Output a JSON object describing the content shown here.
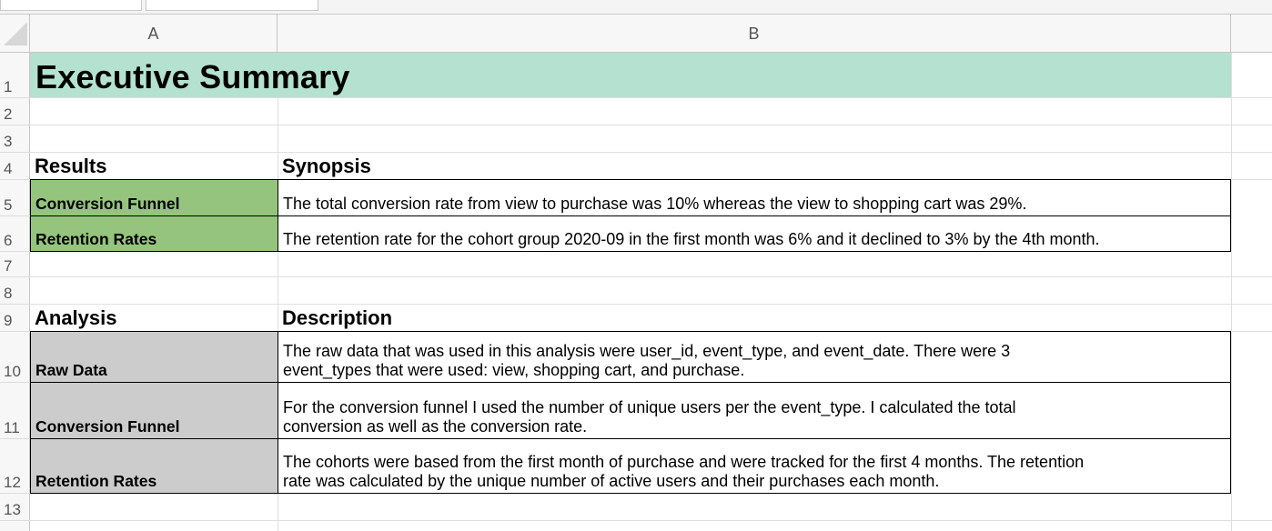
{
  "columns": [
    "A",
    "B"
  ],
  "rows": [
    "1",
    "2",
    "3",
    "4",
    "5",
    "6",
    "7",
    "8",
    "9",
    "10",
    "11",
    "12",
    "13"
  ],
  "sheet": {
    "title": "Executive Summary",
    "results_header": "Results",
    "synopsis_header": "Synopsis",
    "results": [
      {
        "label": "Conversion Funnel",
        "text": "The total conversion rate from view to purchase was 10% whereas the view to shopping cart was 29%."
      },
      {
        "label": "Retention Rates",
        "text": "The retention rate for the cohort group 2020-09 in the first month was 6% and it declined to 3% by the 4th month."
      }
    ],
    "analysis_header": "Analysis",
    "description_header": "Description",
    "analysis": [
      {
        "label": "Raw Data",
        "line1": "The raw data that was used in this analysis were user_id, event_type, and event_date. There were 3",
        "line2": "event_types that were used: view, shopping cart, and purchase."
      },
      {
        "label": "Conversion Funnel",
        "line1": "For the conversion funnel I used the number of unique users per the event_type. I calculated the total",
        "line2": "conversion as well as the conversion rate."
      },
      {
        "label": "Retention Rates",
        "line1": "The cohorts were based from the first month of purchase and were tracked for the first 4 months. The retention",
        "line2": "rate was calculated by the unique number of active users and their purchases each month."
      }
    ]
  },
  "colors": {
    "title_band": "#b5e2d0",
    "results_label_fill": "#94c47d",
    "analysis_label_fill": "#cccccc"
  }
}
